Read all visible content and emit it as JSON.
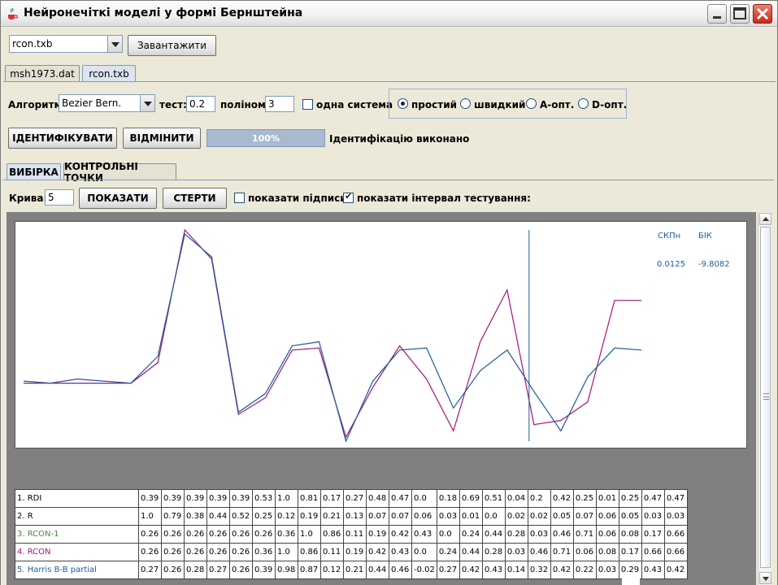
{
  "window": {
    "title": "Нейронечіткі моделі у формі Бернштейна"
  },
  "top": {
    "file_combo_value": "rcon.txb",
    "load_button": "Завантажити"
  },
  "file_tabs": [
    {
      "label": "msh1973.dat"
    },
    {
      "label": "rcon.txb"
    }
  ],
  "algo": {
    "label": "Алгоритм:",
    "value": "Bezier Bern.",
    "test_label": "тест:",
    "test_value": "0.2",
    "poly_label": "поліном:",
    "poly_value": "3",
    "single_system_label": "одна система",
    "radios": [
      {
        "label": "простий",
        "checked": true
      },
      {
        "label": "швидкий",
        "checked": false
      },
      {
        "label": "A-опт.",
        "checked": false
      },
      {
        "label": "D-опт.",
        "checked": false
      }
    ]
  },
  "actions": {
    "identify_button": "ІДЕНТИФІКУВАТИ",
    "cancel_button": "ВІДМІНИТИ",
    "progress_text": "100%",
    "progress_value": 1.0,
    "status_text": "Ідентифікацію виконано"
  },
  "sub_tabs": [
    {
      "label": "ВИБІРКА"
    },
    {
      "label": "КОНТРОЛЬНІ ТОЧКИ"
    }
  ],
  "curve_controls": {
    "curve_label": "Крива:",
    "curve_value": "5",
    "show_button": "ПОКАЗАТИ",
    "clear_button": "СТЕРТИ",
    "show_labels": "показати підписи:",
    "show_labels_checked": false,
    "show_interval": "показати інтервал тестування:",
    "show_interval_checked": true
  },
  "stats": {
    "h1": "СКПн",
    "h2": "БІК",
    "v1": "0.0125",
    "v2": "-9.8082"
  },
  "colors": {
    "series_model": "#1c5b9a",
    "series_rcon": "#a0157a",
    "rcon1": "#4a8a3a",
    "test_line": "#1c5b9a"
  },
  "chart_data": {
    "type": "line",
    "x": [
      1,
      2,
      3,
      4,
      5,
      6,
      7,
      8,
      9,
      10,
      11,
      12,
      13,
      14,
      15,
      16,
      17,
      18,
      19,
      20,
      21,
      22,
      23
    ],
    "series": [
      {
        "name": "4. RCON",
        "color": "#a0157a",
        "values": [
          0.26,
          0.26,
          0.26,
          0.26,
          0.26,
          0.36,
          1.0,
          0.86,
          0.11,
          0.19,
          0.42,
          0.43,
          0.0,
          0.24,
          0.44,
          0.28,
          0.03,
          0.46,
          0.71,
          0.06,
          0.08,
          0.17,
          0.66,
          0.66
        ]
      },
      {
        "name": "5. Harris B-B partial",
        "color": "#1c5b9a",
        "values": [
          0.27,
          0.26,
          0.28,
          0.27,
          0.26,
          0.39,
          0.98,
          0.87,
          0.12,
          0.21,
          0.44,
          0.46,
          -0.02,
          0.27,
          0.42,
          0.43,
          0.14,
          0.32,
          0.42,
          0.22,
          0.03,
          0.29,
          0.43,
          0.42
        ]
      }
    ],
    "test_interval_index": 19,
    "ylim": [
      -0.02,
      1.0
    ]
  },
  "table": {
    "rows": [
      {
        "name": "1. RDI",
        "color": "#000000",
        "values": [
          "0.39",
          "0.39",
          "0.39",
          "0.39",
          "0.39",
          "0.53",
          "1.0",
          "0.81",
          "0.17",
          "0.27",
          "0.48",
          "0.47",
          "0.0",
          "0.18",
          "0.69",
          "0.51",
          "0.04",
          "0.2",
          "0.42",
          "0.25",
          "0.01",
          "0.25",
          "0.47",
          "0.47"
        ]
      },
      {
        "name": "2. R",
        "color": "#000000",
        "values": [
          "1.0",
          "0.79",
          "0.38",
          "0.44",
          "0.52",
          "0.25",
          "0.12",
          "0.19",
          "0.21",
          "0.13",
          "0.07",
          "0.07",
          "0.06",
          "0.03",
          "0.01",
          "0.0",
          "0.02",
          "0.02",
          "0.05",
          "0.07",
          "0.06",
          "0.05",
          "0.03",
          "0.03"
        ]
      },
      {
        "name": "3. RCON-1",
        "color": "#4a8a3a",
        "values": [
          "0.26",
          "0.26",
          "0.26",
          "0.26",
          "0.26",
          "0.26",
          "0.36",
          "1.0",
          "0.86",
          "0.11",
          "0.19",
          "0.42",
          "0.43",
          "0.0",
          "0.24",
          "0.44",
          "0.28",
          "0.03",
          "0.46",
          "0.71",
          "0.06",
          "0.08",
          "0.17",
          "0.66"
        ]
      },
      {
        "name": "4. RCON",
        "color": "#a0157a",
        "values": [
          "0.26",
          "0.26",
          "0.26",
          "0.26",
          "0.26",
          "0.36",
          "1.0",
          "0.86",
          "0.11",
          "0.19",
          "0.42",
          "0.43",
          "0.0",
          "0.24",
          "0.44",
          "0.28",
          "0.03",
          "0.46",
          "0.71",
          "0.06",
          "0.08",
          "0.17",
          "0.66",
          "0.66"
        ]
      },
      {
        "name": "5. Harris B-B partial",
        "color": "#1c5b9a",
        "values": [
          "0.27",
          "0.26",
          "0.28",
          "0.27",
          "0.26",
          "0.39",
          "0.98",
          "0.87",
          "0.12",
          "0.21",
          "0.44",
          "0.46",
          "-0.02",
          "0.27",
          "0.42",
          "0.43",
          "0.14",
          "0.32",
          "0.42",
          "0.22",
          "0.03",
          "0.29",
          "0.43",
          "0.42"
        ]
      }
    ]
  }
}
